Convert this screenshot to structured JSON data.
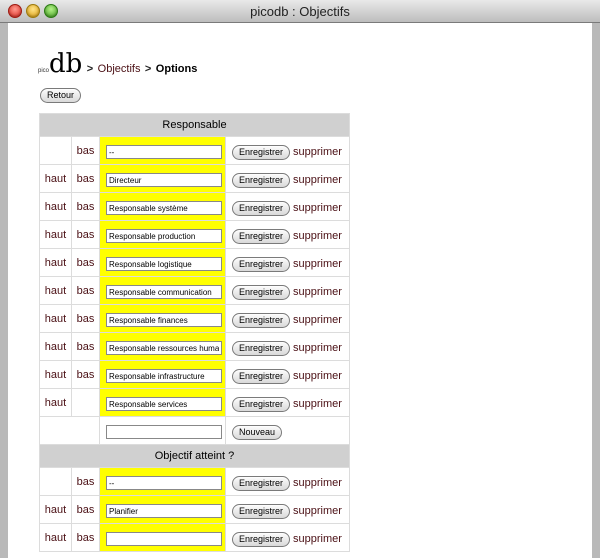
{
  "window": {
    "title": "picodb : Objectifs"
  },
  "logo": {
    "small": "pico",
    "big": "db"
  },
  "breadcrumb": {
    "separator": ">",
    "objectifs": "Objectifs",
    "current": "Options"
  },
  "retour_label": "Retour",
  "sections": [
    {
      "title": "Responsable",
      "rows": [
        {
          "haut": "",
          "bas": "bas",
          "value": "--"
        },
        {
          "haut": "haut",
          "bas": "bas",
          "value": "Directeur"
        },
        {
          "haut": "haut",
          "bas": "bas",
          "value": "Responsable système"
        },
        {
          "haut": "haut",
          "bas": "bas",
          "value": "Responsable production"
        },
        {
          "haut": "haut",
          "bas": "bas",
          "value": "Responsable logistique"
        },
        {
          "haut": "haut",
          "bas": "bas",
          "value": "Responsable communication"
        },
        {
          "haut": "haut",
          "bas": "bas",
          "value": "Responsable finances"
        },
        {
          "haut": "haut",
          "bas": "bas",
          "value": "Responsable ressources humaines"
        },
        {
          "haut": "haut",
          "bas": "bas",
          "value": "Responsable infrastructure"
        },
        {
          "haut": "haut",
          "bas": "",
          "value": "Responsable services"
        }
      ]
    },
    {
      "title": "Objectif atteint ?",
      "rows": [
        {
          "haut": "",
          "bas": "bas",
          "value": "--"
        },
        {
          "haut": "haut",
          "bas": "bas",
          "value": "Planifier"
        },
        {
          "haut": "haut",
          "bas": "bas",
          "value": ""
        }
      ]
    }
  ],
  "labels": {
    "save": "Enregistrer",
    "delete": "supprimer",
    "new": "Nouveau"
  }
}
